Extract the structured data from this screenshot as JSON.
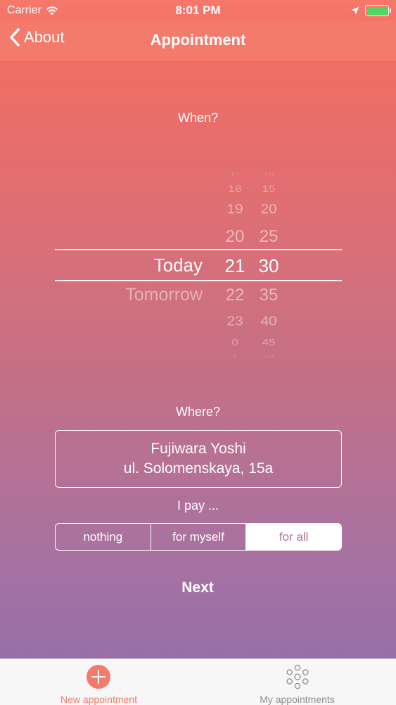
{
  "status_bar": {
    "carrier": "Carrier",
    "time": "8:01 PM",
    "battery_level": 1.0
  },
  "nav_bar": {
    "back_label": "About",
    "title": "Appointment"
  },
  "when": {
    "label": "When?",
    "day_options": [
      {
        "text": "Today",
        "selected": true
      },
      {
        "text": "Tomorrow",
        "selected": false
      }
    ],
    "hour_options": [
      "17",
      "18",
      "19",
      "20",
      "21",
      "22",
      "23",
      "0",
      "1"
    ],
    "minute_options": [
      "10",
      "15",
      "20",
      "25",
      "30",
      "35",
      "40",
      "45",
      "50"
    ],
    "selected_hour": "21",
    "selected_minute": "30"
  },
  "where": {
    "label": "Where?",
    "name": "Fujiwara Yoshi",
    "address": "ul. Solomenskaya, 15a"
  },
  "pay": {
    "label": "I pay ...",
    "options": [
      {
        "label": "nothing",
        "selected": false
      },
      {
        "label": "for myself",
        "selected": false
      },
      {
        "label": "for all",
        "selected": true
      }
    ]
  },
  "next_label": "Next",
  "tab_bar": {
    "tabs": [
      {
        "label": "New appointment",
        "icon": "plus-circle-icon",
        "active": true
      },
      {
        "label": "My appointments",
        "icon": "dots-circle-icon",
        "active": false
      }
    ]
  },
  "colors": {
    "accent": "#f47a6c",
    "tab_inactive": "#8e8e93",
    "segment_selected_text": "#b0749a"
  }
}
